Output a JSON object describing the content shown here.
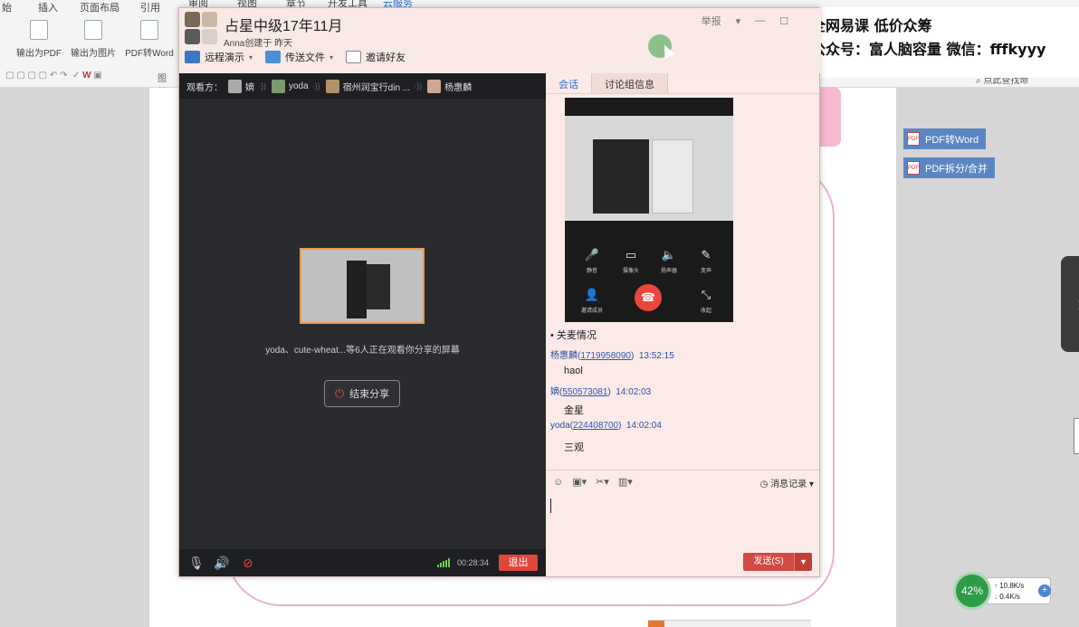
{
  "background_app": {
    "ribbon_tabs": [
      "始",
      "插入",
      "页面布局",
      "引用",
      "审阅",
      "视图",
      "章节",
      "开发工具",
      "云服务"
    ],
    "tools": [
      "输出为PDF",
      "输出为图片",
      "PDF转Word"
    ],
    "quick_label": "图解",
    "search_label": "点此查找命",
    "side_buttons": [
      "PDF转Word",
      "PDF拆分/合并"
    ]
  },
  "watermark": {
    "line1": "全网易课 低价众筹",
    "line2": "公众号：富人脑容量 微信：fffkyyy"
  },
  "window": {
    "group_title": "占星中级17年11月",
    "group_sub": "Anna创建于 昨天",
    "report_label": "举报",
    "toolbar": [
      {
        "label": "远程演示",
        "icon": "presentation-icon"
      },
      {
        "label": "传送文件",
        "icon": "folder-icon"
      },
      {
        "label": "邀请好友",
        "icon": "invite-icon"
      }
    ]
  },
  "video": {
    "viewers_label": "观看方：",
    "viewers": [
      "嫡",
      "yoda",
      "宿州润宝行din ...",
      "杨惠麟"
    ],
    "share_message": "yoda、cute-wheat...等6人正在观看你分享的屏幕",
    "end_share_label": "结束分享",
    "timer": "00:28:34",
    "exit_label": "退出"
  },
  "chat": {
    "tabs": [
      "会话",
      "讨论组信息"
    ],
    "call_controls": [
      "静音",
      "摄像头",
      "扬声器",
      "变声",
      "邀请成员",
      "收起"
    ],
    "messages": [
      {
        "type": "system",
        "text": "• 关麦情况"
      },
      {
        "type": "meta",
        "name": "杨惠麟",
        "qq": "1719958090",
        "time": "13:52:15"
      },
      {
        "type": "body",
        "text": "haol"
      },
      {
        "type": "meta",
        "name": "嫡",
        "qq": "550573081",
        "time": "14:02:03"
      },
      {
        "type": "body",
        "text": "金星"
      },
      {
        "type": "meta",
        "name": "yoda",
        "qq": "224408700",
        "time": "14:02:04"
      },
      {
        "type": "body",
        "text": "三观"
      }
    ],
    "history_label": "消息记录",
    "send_label": "发送(S)"
  },
  "net_widget": {
    "percent": "42%",
    "upload": "10.8K/s",
    "download": "0.4K/s"
  },
  "colors": {
    "accent_red": "#d24a43",
    "window_bg": "#f9e9e6",
    "video_bg": "#2a2b2e",
    "link_blue": "#2a5bbd"
  }
}
